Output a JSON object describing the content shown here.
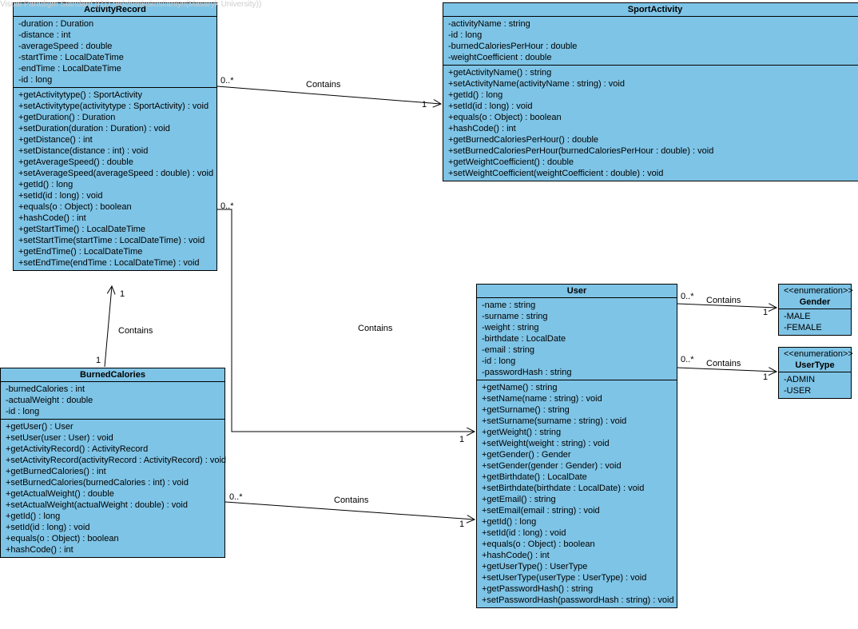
{
  "watermark": "Visual Paradigm Standard (ITD redchenkokostiantyn(Masaryk University))",
  "classes": {
    "activityRecord": {
      "name": "ActivityRecord",
      "attributes": [
        "-duration : Duration",
        "-distance : int",
        "-averageSpeed : double",
        "-startTime : LocalDateTime",
        "-endTime : LocalDateTime",
        "-id : long"
      ],
      "operations": [
        "+getActivitytype() : SportActivity",
        "+setActivitytype(activitytype : SportActivity) : void",
        "+getDuration() : Duration",
        "+setDuration(duration : Duration) : void",
        "+getDistance() : int",
        "+setDistance(distance : int) : void",
        "+getAverageSpeed() : double",
        "+setAverageSpeed(averageSpeed : double) : void",
        "+getId() : long",
        "+setId(id : long) : void",
        "+equals(o : Object) : boolean",
        "+hashCode() : int",
        "+getStartTime() : LocalDateTime",
        "+setStartTime(startTime : LocalDateTime) : void",
        "+getEndTime() : LocalDateTime",
        "+setEndTime(endTime : LocalDateTime) : void"
      ]
    },
    "sportActivity": {
      "name": "SportActivity",
      "attributes": [
        "-activityName : string",
        "-id : long",
        "-burnedCaloriesPerHour : double",
        "-weightCoefficient : double"
      ],
      "operations": [
        "+getActivityName() : string",
        "+setActivityName(activityName : string) : void",
        "+getId() : long",
        "+setId(id : long) : void",
        "+equals(o : Object) : boolean",
        "+hashCode() : int",
        "+getBurnedCaloriesPerHour() : double",
        "+setBurnedCaloriesPerHour(burnedCaloriesPerHour : double) : void",
        "+getWeightCoefficient() : double",
        "+setWeightCoefficient(weightCoefficient : double) : void"
      ]
    },
    "user": {
      "name": "User",
      "attributes": [
        "-name : string",
        "-surname : string",
        "-weight : string",
        "-birthdate : LocalDate",
        "-email : string",
        "-id : long",
        "-passwordHash : string"
      ],
      "operations": [
        "+getName() : string",
        "+setName(name : string) : void",
        "+getSurname() : string",
        "+setSurname(surname : string) : void",
        "+getWeight() : string",
        "+setWeight(weight : string) : void",
        "+getGender() : Gender",
        "+setGender(gender : Gender) : void",
        "+getBirthdate() : LocalDate",
        "+setBirthdate(birthdate : LocalDate) : void",
        "+getEmail() : string",
        "+setEmail(email : string) : void",
        "+getId() : long",
        "+setId(id : long) : void",
        "+equals(o : Object) : boolean",
        "+hashCode() : int",
        "+getUserType() : UserType",
        "+setUserType(userType : UserType) : void",
        "+getPasswordHash() : string",
        "+setPasswordHash(passwordHash : string) : void"
      ]
    },
    "burnedCalories": {
      "name": "BurnedCalories",
      "attributes": [
        "-burnedCalories : int",
        "-actualWeight : double",
        "-id : long"
      ],
      "operations": [
        "+getUser() : User",
        "+setUser(user : User) : void",
        "+getActivityRecord() : ActivityRecord",
        "+setActivityRecord(activityRecord : ActivityRecord) : void",
        "+getBurnedCalories() : int",
        "+setBurnedCalories(burnedCalories : int) : void",
        "+getActualWeight() : double",
        "+setActualWeight(actualWeight : double) : void",
        "+getId() : long",
        "+setId(id : long) : void",
        "+equals(o : Object) : boolean",
        "+hashCode() : int"
      ]
    },
    "gender": {
      "stereotype": "<<enumeration>>",
      "name": "Gender",
      "attributes": [
        "-MALE",
        "-FEMALE"
      ]
    },
    "userType": {
      "stereotype": "<<enumeration>>",
      "name": "UserType",
      "attributes": [
        "-ADMIN",
        "-USER"
      ]
    }
  },
  "associations": {
    "ar_sa": {
      "label": "Contains",
      "mult_from": "0..*",
      "mult_to": "1"
    },
    "ar_user": {
      "label": "Contains",
      "mult_from": "0..*",
      "mult_to": "1"
    },
    "bc_ar": {
      "label": "Contains",
      "mult_from": "1",
      "mult_to": "1"
    },
    "bc_user": {
      "label": "Contains",
      "mult_from": "0..*",
      "mult_to": "1"
    },
    "user_gender": {
      "label": "Contains",
      "mult_from": "0..*",
      "mult_to": "1"
    },
    "user_usertype": {
      "label": "Contains",
      "mult_from": "0..*",
      "mult_to": "1"
    }
  }
}
